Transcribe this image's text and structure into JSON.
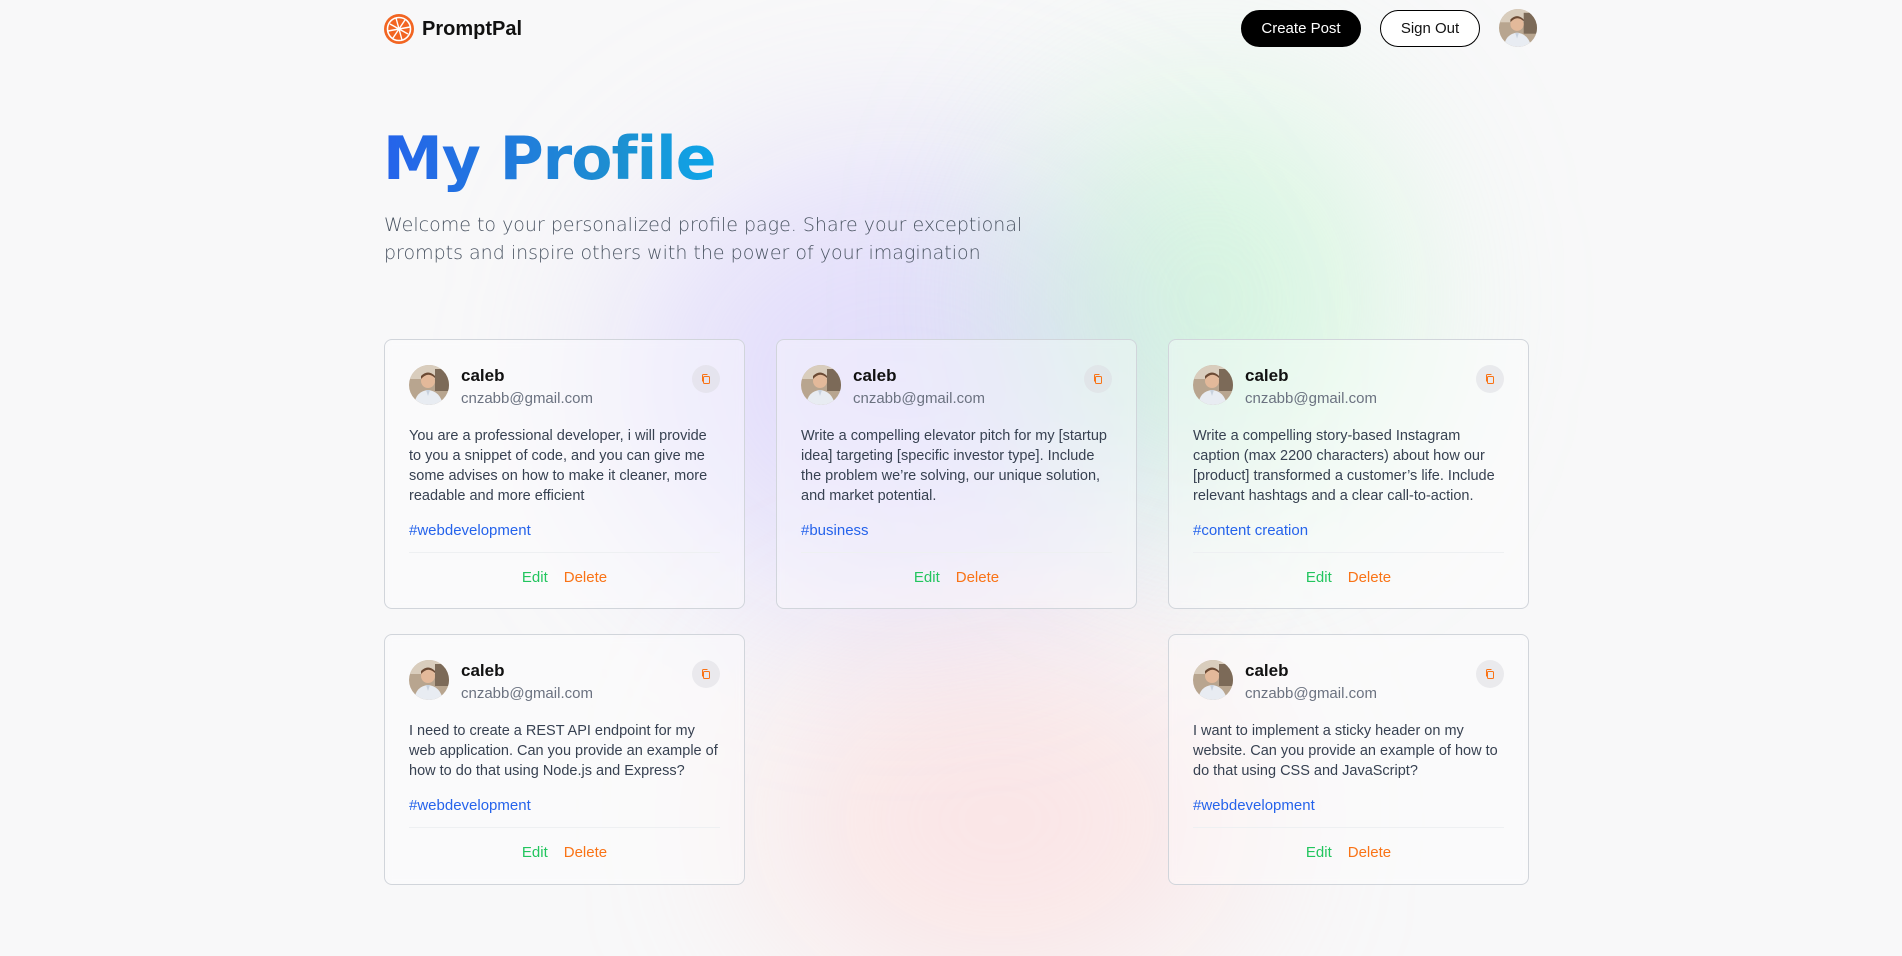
{
  "brand": {
    "name": "PromptPal",
    "logo_icon": "logo-icon",
    "logo_color": "#f26522"
  },
  "nav": {
    "create_post": "Create Post",
    "sign_out": "Sign Out",
    "avatar_icon": "user-avatar"
  },
  "hero": {
    "title": "My Profile",
    "description": "Welcome to your personalized profile page. Share your exceptional prompts and inspire others with the power of your imagination"
  },
  "colors": {
    "accent": "#2563eb",
    "edit": "#22c55e",
    "delete": "#f97316"
  },
  "posts": [
    {
      "username": "caleb",
      "email": "cnzabb@gmail.com",
      "prompt": "You are a professional developer, i will provide to you a snippet of code, and you can give me some advises on how to make it cleaner, more readable and more efficient",
      "tag": "#webdevelopment",
      "edit": "Edit",
      "delete": "Delete"
    },
    {
      "username": "caleb",
      "email": "cnzabb@gmail.com",
      "prompt": "Write a compelling elevator pitch for my [startup idea] targeting [specific investor type]. Include the problem we’re solving, our unique solution, and market potential.",
      "tag": "#business",
      "edit": "Edit",
      "delete": "Delete"
    },
    {
      "username": "caleb",
      "email": "cnzabb@gmail.com",
      "prompt": "Write a compelling story-based Instagram caption (max 2200 characters) about how our [product] transformed a customer’s life. Include relevant hashtags and a clear call-to-action.",
      "tag": "#content creation",
      "edit": "Edit",
      "delete": "Delete"
    },
    {
      "username": "caleb",
      "email": "cnzabb@gmail.com",
      "prompt": "I need to create a REST API endpoint for my web application. Can you provide an example of how to do that using Node.js and Express?",
      "tag": "#webdevelopment",
      "edit": "Edit",
      "delete": "Delete"
    },
    {
      "username": "caleb",
      "email": "cnzabb@gmail.com",
      "prompt": "I want to implement a sticky header on my website. Can you provide an example of how to do that using CSS and JavaScript?",
      "tag": "#webdevelopment",
      "edit": "Edit",
      "delete": "Delete"
    }
  ]
}
